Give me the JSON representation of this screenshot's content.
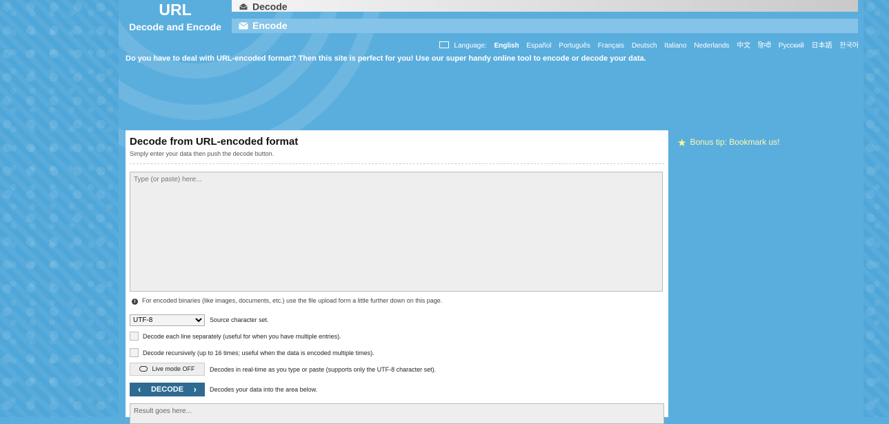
{
  "header": {
    "logo_big": "URL",
    "logo_sub": "Decode and Encode"
  },
  "tabs": {
    "decode_label": "Decode",
    "encode_label": "Encode"
  },
  "language": {
    "label": "Language:",
    "items": [
      "English",
      "Español",
      "Português",
      "Français",
      "Deutsch",
      "Italiano",
      "Nederlands",
      "中文",
      "हिन्दी",
      "Русский",
      "日本語",
      "한국어"
    ],
    "active": "English"
  },
  "intro": "Do you have to deal with URL-encoded format? Then this site is perfect for you! Use our super handy online tool to encode or decode your data.",
  "panel": {
    "title": "Decode from URL-encoded format",
    "hint": "Simply enter your data then push the decode button.",
    "input_placeholder": "Type (or paste) here...",
    "info": "For encoded binaries (like images, documents, etc.) use the file upload form a little further down on this page.",
    "charset_value": "UTF-8",
    "charset_label": "Source character set.",
    "option_lines": "Decode each line separately (useful for when you have multiple entries).",
    "option_recursive": "Decode recursively (up to 16 times; useful when the data is encoded multiple times).",
    "live_label": "Live mode OFF",
    "live_desc": "Decodes in real-time as you type or paste (supports only the UTF-8 character set).",
    "decode_label": "DECODE",
    "decode_desc": "Decodes your data into the area below.",
    "result_placeholder": "Result goes here..."
  },
  "bonus": "Bonus tip: Bookmark us!"
}
